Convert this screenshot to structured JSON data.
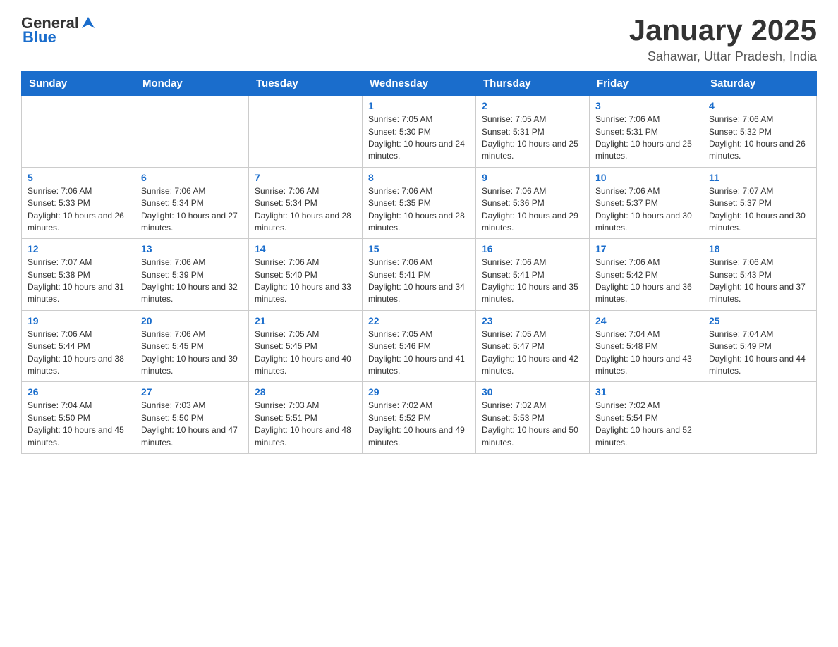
{
  "header": {
    "logo_general": "General",
    "logo_blue": "Blue",
    "title": "January 2025",
    "subtitle": "Sahawar, Uttar Pradesh, India"
  },
  "days_of_week": [
    "Sunday",
    "Monday",
    "Tuesday",
    "Wednesday",
    "Thursday",
    "Friday",
    "Saturday"
  ],
  "weeks": [
    [
      {
        "day": "",
        "info": ""
      },
      {
        "day": "",
        "info": ""
      },
      {
        "day": "",
        "info": ""
      },
      {
        "day": "1",
        "info": "Sunrise: 7:05 AM\nSunset: 5:30 PM\nDaylight: 10 hours and 24 minutes."
      },
      {
        "day": "2",
        "info": "Sunrise: 7:05 AM\nSunset: 5:31 PM\nDaylight: 10 hours and 25 minutes."
      },
      {
        "day": "3",
        "info": "Sunrise: 7:06 AM\nSunset: 5:31 PM\nDaylight: 10 hours and 25 minutes."
      },
      {
        "day": "4",
        "info": "Sunrise: 7:06 AM\nSunset: 5:32 PM\nDaylight: 10 hours and 26 minutes."
      }
    ],
    [
      {
        "day": "5",
        "info": "Sunrise: 7:06 AM\nSunset: 5:33 PM\nDaylight: 10 hours and 26 minutes."
      },
      {
        "day": "6",
        "info": "Sunrise: 7:06 AM\nSunset: 5:34 PM\nDaylight: 10 hours and 27 minutes."
      },
      {
        "day": "7",
        "info": "Sunrise: 7:06 AM\nSunset: 5:34 PM\nDaylight: 10 hours and 28 minutes."
      },
      {
        "day": "8",
        "info": "Sunrise: 7:06 AM\nSunset: 5:35 PM\nDaylight: 10 hours and 28 minutes."
      },
      {
        "day": "9",
        "info": "Sunrise: 7:06 AM\nSunset: 5:36 PM\nDaylight: 10 hours and 29 minutes."
      },
      {
        "day": "10",
        "info": "Sunrise: 7:06 AM\nSunset: 5:37 PM\nDaylight: 10 hours and 30 minutes."
      },
      {
        "day": "11",
        "info": "Sunrise: 7:07 AM\nSunset: 5:37 PM\nDaylight: 10 hours and 30 minutes."
      }
    ],
    [
      {
        "day": "12",
        "info": "Sunrise: 7:07 AM\nSunset: 5:38 PM\nDaylight: 10 hours and 31 minutes."
      },
      {
        "day": "13",
        "info": "Sunrise: 7:06 AM\nSunset: 5:39 PM\nDaylight: 10 hours and 32 minutes."
      },
      {
        "day": "14",
        "info": "Sunrise: 7:06 AM\nSunset: 5:40 PM\nDaylight: 10 hours and 33 minutes."
      },
      {
        "day": "15",
        "info": "Sunrise: 7:06 AM\nSunset: 5:41 PM\nDaylight: 10 hours and 34 minutes."
      },
      {
        "day": "16",
        "info": "Sunrise: 7:06 AM\nSunset: 5:41 PM\nDaylight: 10 hours and 35 minutes."
      },
      {
        "day": "17",
        "info": "Sunrise: 7:06 AM\nSunset: 5:42 PM\nDaylight: 10 hours and 36 minutes."
      },
      {
        "day": "18",
        "info": "Sunrise: 7:06 AM\nSunset: 5:43 PM\nDaylight: 10 hours and 37 minutes."
      }
    ],
    [
      {
        "day": "19",
        "info": "Sunrise: 7:06 AM\nSunset: 5:44 PM\nDaylight: 10 hours and 38 minutes."
      },
      {
        "day": "20",
        "info": "Sunrise: 7:06 AM\nSunset: 5:45 PM\nDaylight: 10 hours and 39 minutes."
      },
      {
        "day": "21",
        "info": "Sunrise: 7:05 AM\nSunset: 5:45 PM\nDaylight: 10 hours and 40 minutes."
      },
      {
        "day": "22",
        "info": "Sunrise: 7:05 AM\nSunset: 5:46 PM\nDaylight: 10 hours and 41 minutes."
      },
      {
        "day": "23",
        "info": "Sunrise: 7:05 AM\nSunset: 5:47 PM\nDaylight: 10 hours and 42 minutes."
      },
      {
        "day": "24",
        "info": "Sunrise: 7:04 AM\nSunset: 5:48 PM\nDaylight: 10 hours and 43 minutes."
      },
      {
        "day": "25",
        "info": "Sunrise: 7:04 AM\nSunset: 5:49 PM\nDaylight: 10 hours and 44 minutes."
      }
    ],
    [
      {
        "day": "26",
        "info": "Sunrise: 7:04 AM\nSunset: 5:50 PM\nDaylight: 10 hours and 45 minutes."
      },
      {
        "day": "27",
        "info": "Sunrise: 7:03 AM\nSunset: 5:50 PM\nDaylight: 10 hours and 47 minutes."
      },
      {
        "day": "28",
        "info": "Sunrise: 7:03 AM\nSunset: 5:51 PM\nDaylight: 10 hours and 48 minutes."
      },
      {
        "day": "29",
        "info": "Sunrise: 7:02 AM\nSunset: 5:52 PM\nDaylight: 10 hours and 49 minutes."
      },
      {
        "day": "30",
        "info": "Sunrise: 7:02 AM\nSunset: 5:53 PM\nDaylight: 10 hours and 50 minutes."
      },
      {
        "day": "31",
        "info": "Sunrise: 7:02 AM\nSunset: 5:54 PM\nDaylight: 10 hours and 52 minutes."
      },
      {
        "day": "",
        "info": ""
      }
    ]
  ]
}
